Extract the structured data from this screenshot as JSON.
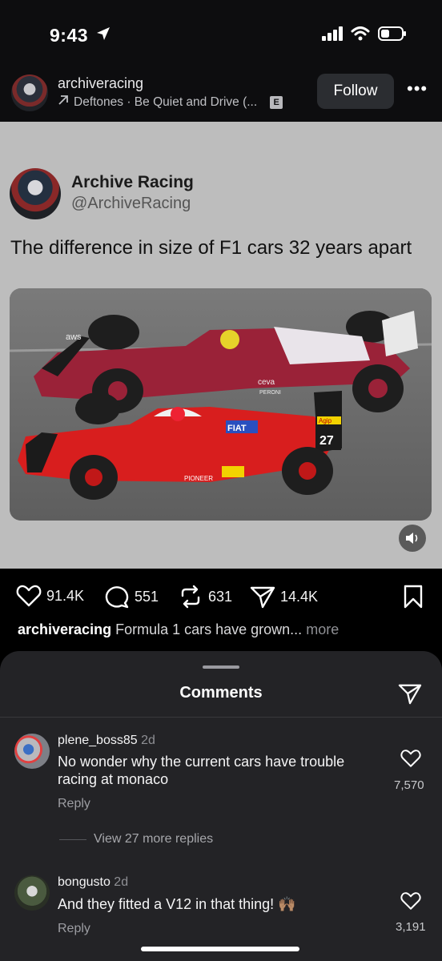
{
  "status_bar": {
    "time": "9:43"
  },
  "post": {
    "username": "archiveracing",
    "audio": "Deftones · Be Quiet and Drive (...",
    "explicit_badge": "E",
    "follow_label": "Follow",
    "more_label": "•••"
  },
  "tweet": {
    "name": "Archive Racing",
    "handle": "@ArchiveRacing",
    "text": "The difference in size of F1 cars 32 years apart",
    "media": {
      "car_top_number": "",
      "car_bottom_number": "27",
      "sponsor_labels": [
        "aws",
        "ceva",
        "PERONI",
        "Agip",
        "PIONEER",
        "FIAT"
      ]
    }
  },
  "actions": {
    "likes": "91.4K",
    "comments": "551",
    "reposts": "631",
    "shares": "14.4K"
  },
  "caption": {
    "user": "archiveracing",
    "text": "Formula 1 cars have grown...",
    "more": "more"
  },
  "comments_sheet": {
    "title": "Comments",
    "comments": [
      {
        "user": "plene_boss85",
        "ago": "2d",
        "text": "No wonder why the current cars have trouble racing at monaco",
        "reply": "Reply",
        "likes": "7,570",
        "view_replies": "View 27 more replies"
      },
      {
        "user": "bongusto",
        "ago": "2d",
        "text": "And they fitted a V12 in that thing! 🙌🏽",
        "reply": "Reply",
        "likes": "3,191"
      }
    ]
  },
  "colors": {
    "background": "#000000",
    "sheet": "#232326",
    "card": "#bdbdbd",
    "modern_car": "#9a2238",
    "classic_car": "#d81e1e"
  }
}
